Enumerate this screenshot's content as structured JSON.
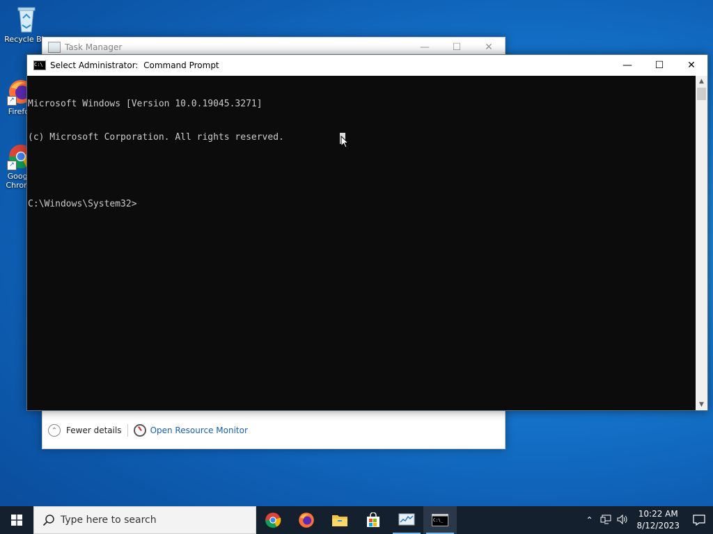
{
  "desktop": {
    "icons": [
      {
        "name": "recycle-bin",
        "label": "Recycle Bin"
      },
      {
        "name": "firefox",
        "label": "Firefox"
      },
      {
        "name": "google-chrome",
        "label": "Google Chrome"
      }
    ]
  },
  "taskmgr": {
    "title": "Task Manager",
    "fewer_details": "Fewer details",
    "open_resource_monitor": "Open Resource Monitor"
  },
  "cmd": {
    "title": "Select Administrator:  Command Prompt",
    "lines": [
      "Microsoft Windows [Version 10.0.19045.3271]",
      "(c) Microsoft Corporation. All rights reserved.",
      "",
      "C:\\Windows\\System32>"
    ]
  },
  "taskbar": {
    "search_placeholder": "Type here to search",
    "apps": [
      "chrome-icon",
      "firefox-icon",
      "file-explorer-icon",
      "store-icon",
      "task-manager-icon",
      "command-prompt-icon"
    ],
    "clock_time": "10:22 AM",
    "clock_date": "8/12/2023"
  },
  "colors": {
    "console_bg": "#0c0c0c",
    "console_text": "#cccccc",
    "taskbar_bg": "#15202e",
    "link": "#1a5ea8"
  }
}
